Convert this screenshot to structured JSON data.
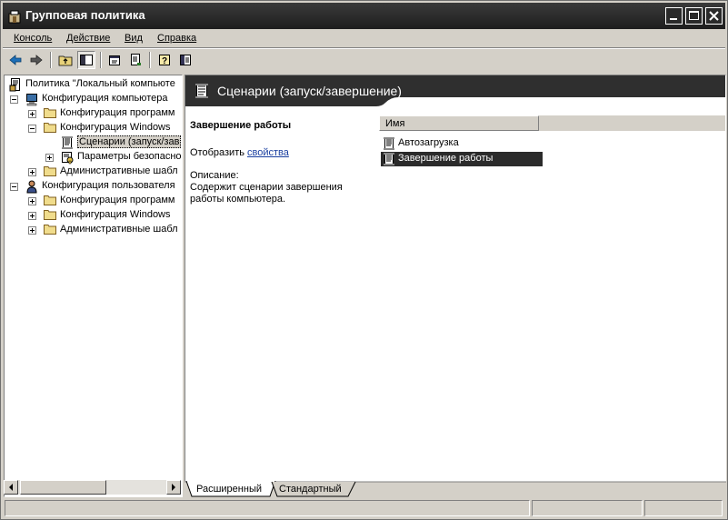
{
  "window": {
    "title": "Групповая политика"
  },
  "menu": [
    "Консоль",
    "Действие",
    "Вид",
    "Справка"
  ],
  "tree": [
    {
      "label": "Политика \"Локальный компьюте",
      "level": 0,
      "expander": "none",
      "icon": "policy-icon"
    },
    {
      "label": "Конфигурация компьютера",
      "level": 1,
      "expander": "minus",
      "icon": "computer-icon"
    },
    {
      "label": "Конфигурация программ",
      "level": 2,
      "expander": "plus",
      "icon": "folder-icon"
    },
    {
      "label": "Конфигурация Windows",
      "level": 2,
      "expander": "minus",
      "icon": "folder-icon"
    },
    {
      "label": "Сценарии (запуск/зав",
      "level": 3,
      "expander": "none",
      "icon": "script-icon",
      "selected": true
    },
    {
      "label": "Параметры безопасно",
      "level": 3,
      "expander": "plus",
      "icon": "security-icon"
    },
    {
      "label": "Административные шабл",
      "level": 2,
      "expander": "plus",
      "icon": "folder-icon"
    },
    {
      "label": "Конфигурация пользователя",
      "level": 1,
      "expander": "minus",
      "icon": "user-icon"
    },
    {
      "label": "Конфигурация программ",
      "level": 2,
      "expander": "plus",
      "icon": "folder-icon"
    },
    {
      "label": "Конфигурация Windows",
      "level": 2,
      "expander": "plus",
      "icon": "folder-icon"
    },
    {
      "label": "Административные шабл",
      "level": 2,
      "expander": "plus",
      "icon": "folder-icon"
    }
  ],
  "right": {
    "header": "Сценарии (запуск/завершение)",
    "desc_title": "Завершение работы",
    "show_prefix": "Отобразить ",
    "show_link": "свойства",
    "desc_label": "Описание:",
    "desc_text": "Содержит сценарии завершения работы компьютера.",
    "col_name": "Имя",
    "items": [
      {
        "label": "Автозагрузка",
        "selected": false
      },
      {
        "label": "Завершение работы",
        "selected": true
      }
    ]
  },
  "tabs": [
    {
      "label": "Расширенный",
      "active": true
    },
    {
      "label": "Стандартный",
      "active": false
    }
  ]
}
